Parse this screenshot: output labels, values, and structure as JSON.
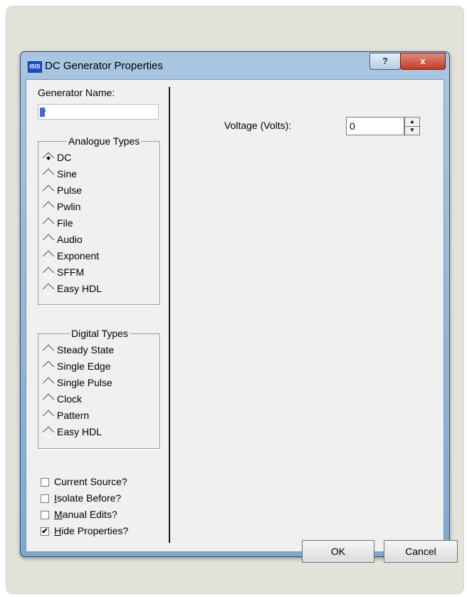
{
  "window": {
    "title": "DC Generator Properties",
    "icon_text": "ISIS",
    "help_glyph": "?",
    "close_glyph": "x"
  },
  "generator_name": {
    "label": "Generator Name:",
    "value": "?"
  },
  "analogue_types": {
    "legend": "Analogue Types",
    "selected": "DC",
    "items": [
      {
        "label": "DC",
        "checked": true
      },
      {
        "label": "Sine",
        "checked": false
      },
      {
        "label": "Pulse",
        "checked": false
      },
      {
        "label": "Pwlin",
        "checked": false
      },
      {
        "label": "File",
        "checked": false
      },
      {
        "label": "Audio",
        "checked": false
      },
      {
        "label": "Exponent",
        "checked": false
      },
      {
        "label": "SFFM",
        "checked": false
      },
      {
        "label": "Easy HDL",
        "checked": false
      }
    ]
  },
  "digital_types": {
    "legend": "Digital Types",
    "items": [
      {
        "label": "Steady State",
        "checked": false
      },
      {
        "label": "Single Edge",
        "checked": false
      },
      {
        "label": "Single Pulse",
        "checked": false
      },
      {
        "label": "Clock",
        "checked": false
      },
      {
        "label": "Pattern",
        "checked": false
      },
      {
        "label": "Easy HDL",
        "checked": false
      }
    ]
  },
  "options": [
    {
      "label_mnemonic": "",
      "label_rest": "Current Source?",
      "checked": false,
      "mark": ""
    },
    {
      "label_mnemonic": "I",
      "label_rest": "solate Before?",
      "checked": false,
      "mark": ""
    },
    {
      "label_mnemonic": "M",
      "label_rest": "anual Edits?",
      "checked": false,
      "mark": ""
    },
    {
      "label_mnemonic": "H",
      "label_rest": "ide Properties?",
      "checked": true,
      "mark": "✔"
    }
  ],
  "voltage": {
    "label": "Voltage (Volts):",
    "value": "0"
  },
  "buttons": {
    "ok": "OK",
    "cancel": "Cancel"
  }
}
